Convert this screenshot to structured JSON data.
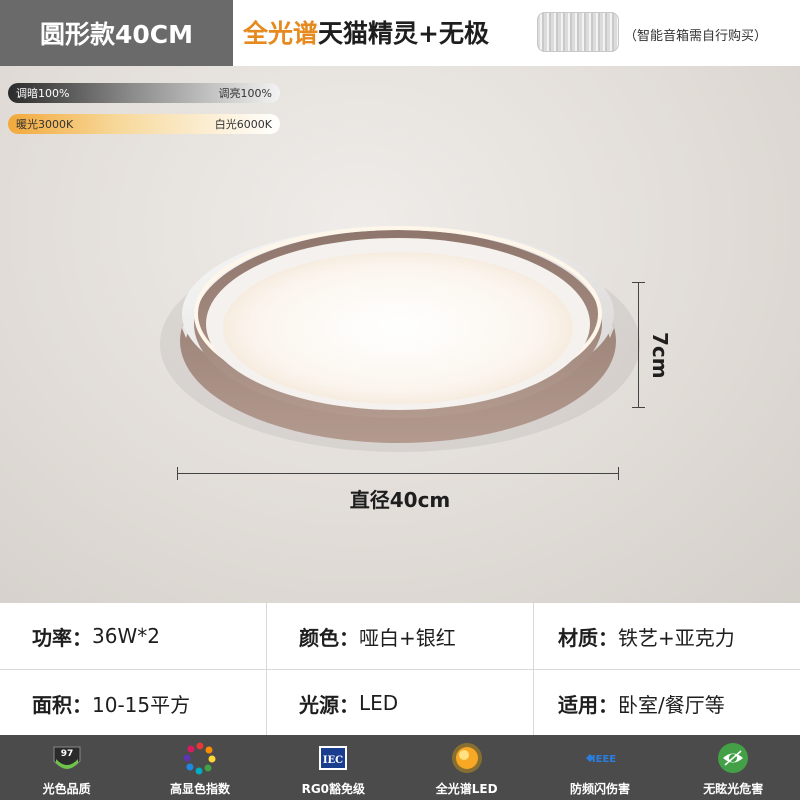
{
  "header": {
    "model": "圆形款40CM",
    "title_highlight": "全光谱",
    "title_rest": "天猫精灵+无极",
    "speaker_note": "（智能音箱需自行购买）"
  },
  "sliders": {
    "dim_left": "调暗100%",
    "dim_right": "调亮100%",
    "temp_left": "暖光3000K",
    "temp_right": "白光6000K"
  },
  "dimensions": {
    "height": "7cm",
    "diameter": "直径40cm"
  },
  "specs": [
    {
      "key": "功率：",
      "value": "36W*2"
    },
    {
      "key": "颜色：",
      "value": "哑白+银红"
    },
    {
      "key": "材质：",
      "value": "铁艺+亚克力"
    },
    {
      "key": "面积：",
      "value": "10-15平方"
    },
    {
      "key": "光源：",
      "value": "LED"
    },
    {
      "key": "适用：",
      "value": "卧室/餐厅等"
    }
  ],
  "features": [
    {
      "icon": "ra97-icon",
      "label": "光色品质",
      "badge": "97"
    },
    {
      "icon": "color-wheel-icon",
      "label": "高显色指数"
    },
    {
      "icon": "iec-icon",
      "label": "RG0豁免级",
      "badge": "IEC"
    },
    {
      "icon": "sun-icon",
      "label": "全光谱LED"
    },
    {
      "icon": "ieee-icon",
      "label": "防频闪伤害",
      "badge": "IEEE"
    },
    {
      "icon": "eye-icon",
      "label": "无眩光危害"
    }
  ],
  "colors": {
    "accent_orange": "#e58a1e",
    "model_tag_bg": "#6a6a6a",
    "feature_bar_bg": "#4b4b4b",
    "lamp_rose": "#a8887c"
  }
}
